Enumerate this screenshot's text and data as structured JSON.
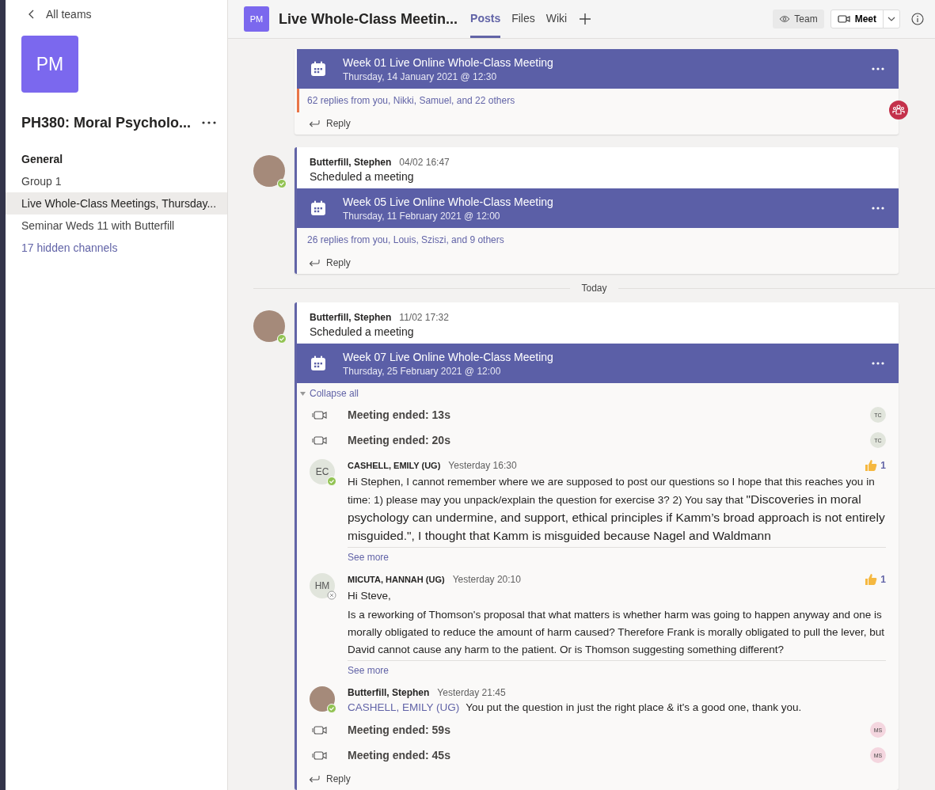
{
  "sidebar": {
    "back_label": "All teams",
    "team_initials": "PM",
    "team_name": "PH380: Moral Psycholo...",
    "channels": [
      {
        "label": "General",
        "kind": "unread",
        "selected": false
      },
      {
        "label": "Group 1",
        "kind": "normal",
        "selected": false
      },
      {
        "label": "Live Whole-Class Meetings, Thursday...",
        "kind": "normal",
        "selected": true
      },
      {
        "label": "Seminar Weds 11 with Butterfill",
        "kind": "normal",
        "selected": false
      },
      {
        "label": "17 hidden channels",
        "kind": "link",
        "selected": false
      }
    ]
  },
  "header": {
    "initials": "PM",
    "title": "Live Whole-Class Meetin...",
    "tabs": [
      {
        "label": "Posts",
        "selected": true
      },
      {
        "label": "Files",
        "selected": false
      },
      {
        "label": "Wiki",
        "selected": false
      }
    ],
    "team_button": "Team",
    "meet_button": "Meet"
  },
  "posts": [
    {
      "meeting": {
        "title": "Week 01 Live Online Whole-Class Meeting",
        "date": "Thursday, 14 January 2021 @ 12:30"
      },
      "replies_summary": "62 replies from you, Nikki, Samuel, and 22 others",
      "unread": true,
      "reply_label": "Reply"
    },
    {
      "author": "Butterfill, Stephen",
      "time": "04/02 16:47",
      "text": "Scheduled a meeting",
      "available": true,
      "meeting": {
        "title": "Week 05 Live Online Whole-Class Meeting",
        "date": "Thursday, 11 February 2021 @ 12:00"
      },
      "replies_summary": "26 replies from you, Louis, Sziszi, and 9 others",
      "unread": false,
      "reply_label": "Reply"
    },
    {
      "divider": "Today",
      "author": "Butterfill, Stephen",
      "time": "11/02 17:32",
      "text": "Scheduled a meeting",
      "available": true,
      "meeting": {
        "title": "Week 07 Live Online Whole-Class Meeting",
        "date": "Thursday, 25 February 2021 @ 12:00"
      },
      "collapse_label": "Collapse all",
      "reply_label": "Reply",
      "thread": [
        {
          "kind": "ended",
          "text": "Meeting ended: 13s",
          "initials": "TC",
          "color": "#e1e5dc"
        },
        {
          "kind": "ended",
          "text": "Meeting ended: 20s",
          "initials": "TC",
          "color": "#e1e5dc"
        },
        {
          "kind": "message",
          "initials": "EC",
          "author": "CASHELL, EMILY (UG)",
          "time": "Yesterday 16:30",
          "available": true,
          "reaction": "1",
          "paragraphs": [
            {
              "segments": [
                {
                  "kind": "plain",
                  "text": "Hi Stephen, I cannot remember where we are supposed to post our questions so I hope that this reaches you in time: 1) please may you unpack/explain the question for exercise 3? 2) You say that "
                },
                {
                  "kind": "pasted",
                  "text": "\"Discoveries in moral psychology can undermine, and support, ethical principles if Kamm’s broad approach is not entirely misguided.\", I thought that Kamm is misguided because Nagel and Waldmann"
                }
              ]
            }
          ],
          "see_more": "See more"
        },
        {
          "kind": "message",
          "initials": "HM",
          "author": "MICUTA, HANNAH (UG)",
          "time": "Yesterday 20:10",
          "available": false,
          "reaction": "1",
          "paragraphs": [
            {
              "segments": [
                {
                  "kind": "plain",
                  "text": "Hi Steve,"
                }
              ]
            },
            {
              "segments": [
                {
                  "kind": "plain",
                  "text": "Is a reworking of Thomson's proposal that what matters is whether harm was going to happen anyway and one is morally obligated to reduce the amount of harm caused? Therefore Frank is morally obligated to pull the lever, but David cannot cause any harm to the patient. Or is Thomson suggesting something different?"
                }
              ]
            }
          ],
          "see_more": "See more"
        },
        {
          "kind": "reply",
          "author": "Butterfill, Stephen",
          "time": "Yesterday 21:45",
          "available": true,
          "mention": "CASHELL, EMILY (UG)",
          "text": "You put the question in just the right place & it's a good one, thank you."
        },
        {
          "kind": "ended",
          "text": "Meeting ended: 59s",
          "initials": "MS",
          "color": "#f4d6df"
        },
        {
          "kind": "ended",
          "text": "Meeting ended: 45s",
          "initials": "MS",
          "color": "#f4d6df"
        }
      ]
    }
  ]
}
